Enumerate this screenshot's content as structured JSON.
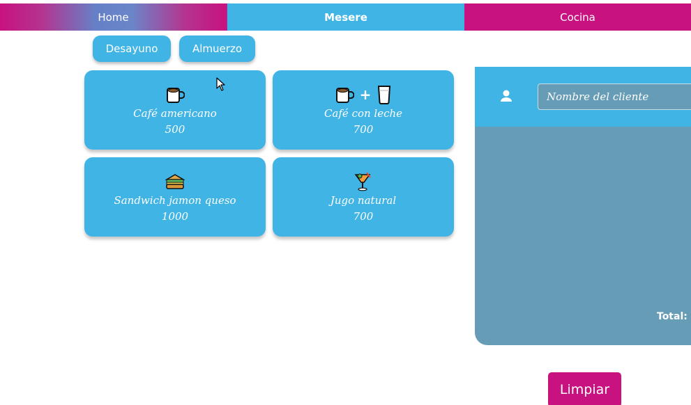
{
  "nav": {
    "home": "Home",
    "mesere": "Mesere",
    "cocina": "Cocina"
  },
  "menu_categories": [
    "Desayuno",
    "Almuerzo"
  ],
  "products": [
    {
      "name": "Café americano",
      "price": "500",
      "icons": [
        "coffee-cup-icon"
      ]
    },
    {
      "name": "Café con leche",
      "price": "700",
      "icons": [
        "coffee-cup-icon",
        "milk-glass-icon"
      ]
    },
    {
      "name": "Sandwich jamon queso",
      "price": "1000",
      "icons": [
        "sandwich-icon"
      ]
    },
    {
      "name": "Jugo natural",
      "price": "700",
      "icons": [
        "juice-glass-icon"
      ]
    }
  ],
  "order": {
    "client_placeholder": "Nombre del cliente",
    "total_label": "Total:"
  },
  "actions": {
    "clear_label": "Limpiar"
  },
  "colors": {
    "primary_blue": "#41b4e6",
    "magenta": "#c8127f",
    "panel_gray_blue": "#669cb6"
  }
}
